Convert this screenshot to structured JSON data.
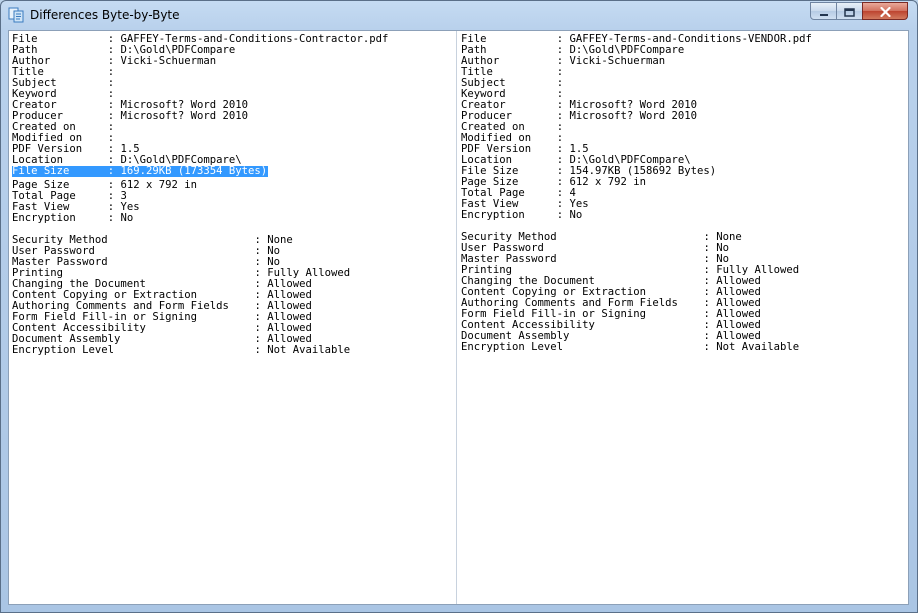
{
  "window": {
    "title": "Differences Byte-by-Byte",
    "icon": "compare-documents-icon",
    "controls": {
      "minimize": "minimize-icon",
      "maximize": "maximize-icon",
      "close": "close-icon"
    }
  },
  "left": {
    "info": [
      {
        "key": "File",
        "value": "GAFFEY-Terms-and-Conditions-Contractor.pdf"
      },
      {
        "key": "Path",
        "value": "D:\\Gold\\PDFCompare"
      },
      {
        "key": "Author",
        "value": "Vicki-Schuerman"
      },
      {
        "key": "Title",
        "value": ""
      },
      {
        "key": "Subject",
        "value": ""
      },
      {
        "key": "Keyword",
        "value": ""
      },
      {
        "key": "Creator",
        "value": "Microsoft? Word 2010"
      },
      {
        "key": "Producer",
        "value": "Microsoft? Word 2010"
      },
      {
        "key": "Created on",
        "value": ""
      },
      {
        "key": "Modified on",
        "value": ""
      },
      {
        "key": "PDF Version",
        "value": "1.5"
      },
      {
        "key": "Location",
        "value": "D:\\Gold\\PDFCompare\\"
      },
      {
        "key": "File Size",
        "value": "169.29KB (173354 Bytes)"
      },
      {
        "key": "Page Size",
        "value": "612 x 792 in"
      },
      {
        "key": "Total Page",
        "value": "3"
      },
      {
        "key": "Fast View",
        "value": "Yes"
      },
      {
        "key": "Encryption",
        "value": "No"
      }
    ],
    "security": [
      {
        "key": "Security Method",
        "value": "None"
      },
      {
        "key": "User Password",
        "value": "No"
      },
      {
        "key": "Master Password",
        "value": "No"
      },
      {
        "key": "Printing",
        "value": "Fully Allowed"
      },
      {
        "key": "Changing the Document",
        "value": "Allowed"
      },
      {
        "key": "Content Copying or Extraction",
        "value": "Allowed"
      },
      {
        "key": "Authoring Comments and Form Fields",
        "value": "Allowed"
      },
      {
        "key": "Form Field Fill-in or Signing",
        "value": "Allowed"
      },
      {
        "key": "Content Accessibility",
        "value": "Allowed"
      },
      {
        "key": "Document Assembly",
        "value": "Allowed"
      },
      {
        "key": "Encryption Level",
        "value": "Not Available"
      }
    ]
  },
  "right": {
    "info": [
      {
        "key": "File",
        "value": "GAFFEY-Terms-and-Conditions-VENDOR.pdf"
      },
      {
        "key": "Path",
        "value": "D:\\Gold\\PDFCompare"
      },
      {
        "key": "Author",
        "value": "Vicki-Schuerman"
      },
      {
        "key": "Title",
        "value": ""
      },
      {
        "key": "Subject",
        "value": ""
      },
      {
        "key": "Keyword",
        "value": ""
      },
      {
        "key": "Creator",
        "value": "Microsoft? Word 2010"
      },
      {
        "key": "Producer",
        "value": "Microsoft? Word 2010"
      },
      {
        "key": "Created on",
        "value": ""
      },
      {
        "key": "Modified on",
        "value": ""
      },
      {
        "key": "PDF Version",
        "value": "1.5"
      },
      {
        "key": "Location",
        "value": "D:\\Gold\\PDFCompare\\"
      },
      {
        "key": "File Size",
        "value": "154.97KB (158692 Bytes)"
      },
      {
        "key": "Page Size",
        "value": "612 x 792 in"
      },
      {
        "key": "Total Page",
        "value": "4"
      },
      {
        "key": "Fast View",
        "value": "Yes"
      },
      {
        "key": "Encryption",
        "value": "No"
      }
    ],
    "security": [
      {
        "key": "Security Method",
        "value": "None"
      },
      {
        "key": "User Password",
        "value": "No"
      },
      {
        "key": "Master Password",
        "value": "No"
      },
      {
        "key": "Printing",
        "value": "Fully Allowed"
      },
      {
        "key": "Changing the Document",
        "value": "Allowed"
      },
      {
        "key": "Content Copying or Extraction",
        "value": "Allowed"
      },
      {
        "key": "Authoring Comments and Form Fields",
        "value": "Allowed"
      },
      {
        "key": "Form Field Fill-in or Signing",
        "value": "Allowed"
      },
      {
        "key": "Content Accessibility",
        "value": "Allowed"
      },
      {
        "key": "Document Assembly",
        "value": "Allowed"
      },
      {
        "key": "Encryption Level",
        "value": "Not Available"
      }
    ]
  },
  "selection": {
    "pane": "left",
    "key": "File Size"
  },
  "separator": ":",
  "colors": {
    "selection": "#3399ff",
    "selection_text": "#ffffff",
    "title_bar": "#b9d1ec",
    "close_button": "#c7503c"
  }
}
